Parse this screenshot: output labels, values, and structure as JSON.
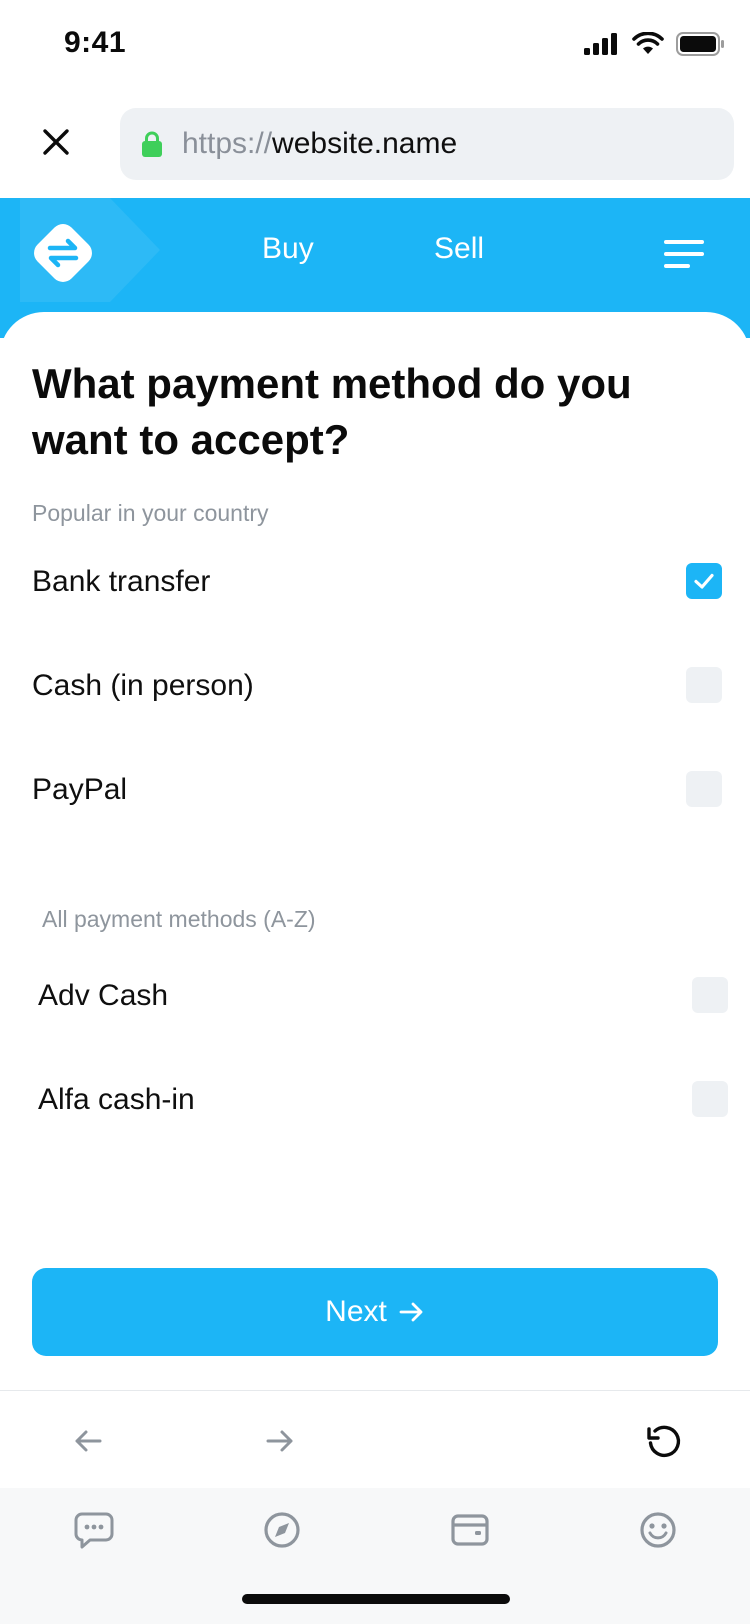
{
  "status_bar": {
    "time": "9:41"
  },
  "browser": {
    "url_scheme": "https://",
    "url_host": "website.name"
  },
  "header": {
    "nav": {
      "buy": "Buy",
      "sell": "Sell"
    }
  },
  "main": {
    "title": "What payment method do you want to accept?",
    "popular_label": "Popular in your country",
    "popular_methods": [
      {
        "label": "Bank transfer",
        "checked": true
      },
      {
        "label": "Cash (in person)",
        "checked": false
      },
      {
        "label": "PayPal",
        "checked": false
      }
    ],
    "all_label": "All payment methods (A-Z)",
    "all_methods": [
      {
        "label": "Adv Cash",
        "checked": false
      },
      {
        "label": "Alfa cash-in",
        "checked": false
      }
    ],
    "next_label": "Next"
  },
  "colors": {
    "accent": "#1cb5f6",
    "checkbox_empty": "#eef1f4",
    "muted_text": "#8e959d"
  },
  "icons": {
    "toolbar": [
      "arrow-left-icon",
      "arrow-right-icon",
      "reload-icon"
    ],
    "tabs": [
      "chat-icon",
      "compass-icon",
      "wallet-icon",
      "smiley-icon"
    ]
  }
}
